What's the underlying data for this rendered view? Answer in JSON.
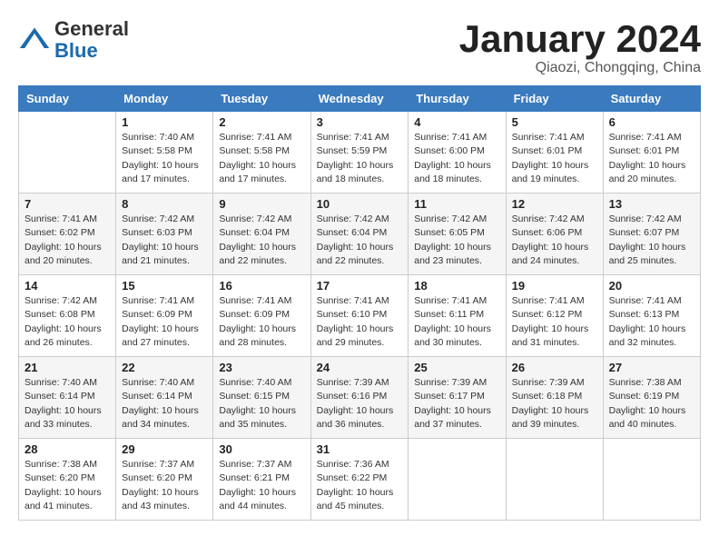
{
  "header": {
    "logo_line1": "General",
    "logo_line2": "Blue",
    "month_title": "January 2024",
    "location": "Qiaozi, Chongqing, China"
  },
  "days_of_week": [
    "Sunday",
    "Monday",
    "Tuesday",
    "Wednesday",
    "Thursday",
    "Friday",
    "Saturday"
  ],
  "weeks": [
    [
      {
        "day": "",
        "sunrise": "",
        "sunset": "",
        "daylight": ""
      },
      {
        "day": "1",
        "sunrise": "Sunrise: 7:40 AM",
        "sunset": "Sunset: 5:58 PM",
        "daylight": "Daylight: 10 hours and 17 minutes."
      },
      {
        "day": "2",
        "sunrise": "Sunrise: 7:41 AM",
        "sunset": "Sunset: 5:58 PM",
        "daylight": "Daylight: 10 hours and 17 minutes."
      },
      {
        "day": "3",
        "sunrise": "Sunrise: 7:41 AM",
        "sunset": "Sunset: 5:59 PM",
        "daylight": "Daylight: 10 hours and 18 minutes."
      },
      {
        "day": "4",
        "sunrise": "Sunrise: 7:41 AM",
        "sunset": "Sunset: 6:00 PM",
        "daylight": "Daylight: 10 hours and 18 minutes."
      },
      {
        "day": "5",
        "sunrise": "Sunrise: 7:41 AM",
        "sunset": "Sunset: 6:01 PM",
        "daylight": "Daylight: 10 hours and 19 minutes."
      },
      {
        "day": "6",
        "sunrise": "Sunrise: 7:41 AM",
        "sunset": "Sunset: 6:01 PM",
        "daylight": "Daylight: 10 hours and 20 minutes."
      }
    ],
    [
      {
        "day": "7",
        "sunrise": "Sunrise: 7:41 AM",
        "sunset": "Sunset: 6:02 PM",
        "daylight": "Daylight: 10 hours and 20 minutes."
      },
      {
        "day": "8",
        "sunrise": "Sunrise: 7:42 AM",
        "sunset": "Sunset: 6:03 PM",
        "daylight": "Daylight: 10 hours and 21 minutes."
      },
      {
        "day": "9",
        "sunrise": "Sunrise: 7:42 AM",
        "sunset": "Sunset: 6:04 PM",
        "daylight": "Daylight: 10 hours and 22 minutes."
      },
      {
        "day": "10",
        "sunrise": "Sunrise: 7:42 AM",
        "sunset": "Sunset: 6:04 PM",
        "daylight": "Daylight: 10 hours and 22 minutes."
      },
      {
        "day": "11",
        "sunrise": "Sunrise: 7:42 AM",
        "sunset": "Sunset: 6:05 PM",
        "daylight": "Daylight: 10 hours and 23 minutes."
      },
      {
        "day": "12",
        "sunrise": "Sunrise: 7:42 AM",
        "sunset": "Sunset: 6:06 PM",
        "daylight": "Daylight: 10 hours and 24 minutes."
      },
      {
        "day": "13",
        "sunrise": "Sunrise: 7:42 AM",
        "sunset": "Sunset: 6:07 PM",
        "daylight": "Daylight: 10 hours and 25 minutes."
      }
    ],
    [
      {
        "day": "14",
        "sunrise": "Sunrise: 7:42 AM",
        "sunset": "Sunset: 6:08 PM",
        "daylight": "Daylight: 10 hours and 26 minutes."
      },
      {
        "day": "15",
        "sunrise": "Sunrise: 7:41 AM",
        "sunset": "Sunset: 6:09 PM",
        "daylight": "Daylight: 10 hours and 27 minutes."
      },
      {
        "day": "16",
        "sunrise": "Sunrise: 7:41 AM",
        "sunset": "Sunset: 6:09 PM",
        "daylight": "Daylight: 10 hours and 28 minutes."
      },
      {
        "day": "17",
        "sunrise": "Sunrise: 7:41 AM",
        "sunset": "Sunset: 6:10 PM",
        "daylight": "Daylight: 10 hours and 29 minutes."
      },
      {
        "day": "18",
        "sunrise": "Sunrise: 7:41 AM",
        "sunset": "Sunset: 6:11 PM",
        "daylight": "Daylight: 10 hours and 30 minutes."
      },
      {
        "day": "19",
        "sunrise": "Sunrise: 7:41 AM",
        "sunset": "Sunset: 6:12 PM",
        "daylight": "Daylight: 10 hours and 31 minutes."
      },
      {
        "day": "20",
        "sunrise": "Sunrise: 7:41 AM",
        "sunset": "Sunset: 6:13 PM",
        "daylight": "Daylight: 10 hours and 32 minutes."
      }
    ],
    [
      {
        "day": "21",
        "sunrise": "Sunrise: 7:40 AM",
        "sunset": "Sunset: 6:14 PM",
        "daylight": "Daylight: 10 hours and 33 minutes."
      },
      {
        "day": "22",
        "sunrise": "Sunrise: 7:40 AM",
        "sunset": "Sunset: 6:14 PM",
        "daylight": "Daylight: 10 hours and 34 minutes."
      },
      {
        "day": "23",
        "sunrise": "Sunrise: 7:40 AM",
        "sunset": "Sunset: 6:15 PM",
        "daylight": "Daylight: 10 hours and 35 minutes."
      },
      {
        "day": "24",
        "sunrise": "Sunrise: 7:39 AM",
        "sunset": "Sunset: 6:16 PM",
        "daylight": "Daylight: 10 hours and 36 minutes."
      },
      {
        "day": "25",
        "sunrise": "Sunrise: 7:39 AM",
        "sunset": "Sunset: 6:17 PM",
        "daylight": "Daylight: 10 hours and 37 minutes."
      },
      {
        "day": "26",
        "sunrise": "Sunrise: 7:39 AM",
        "sunset": "Sunset: 6:18 PM",
        "daylight": "Daylight: 10 hours and 39 minutes."
      },
      {
        "day": "27",
        "sunrise": "Sunrise: 7:38 AM",
        "sunset": "Sunset: 6:19 PM",
        "daylight": "Daylight: 10 hours and 40 minutes."
      }
    ],
    [
      {
        "day": "28",
        "sunrise": "Sunrise: 7:38 AM",
        "sunset": "Sunset: 6:20 PM",
        "daylight": "Daylight: 10 hours and 41 minutes."
      },
      {
        "day": "29",
        "sunrise": "Sunrise: 7:37 AM",
        "sunset": "Sunset: 6:20 PM",
        "daylight": "Daylight: 10 hours and 43 minutes."
      },
      {
        "day": "30",
        "sunrise": "Sunrise: 7:37 AM",
        "sunset": "Sunset: 6:21 PM",
        "daylight": "Daylight: 10 hours and 44 minutes."
      },
      {
        "day": "31",
        "sunrise": "Sunrise: 7:36 AM",
        "sunset": "Sunset: 6:22 PM",
        "daylight": "Daylight: 10 hours and 45 minutes."
      },
      {
        "day": "",
        "sunrise": "",
        "sunset": "",
        "daylight": ""
      },
      {
        "day": "",
        "sunrise": "",
        "sunset": "",
        "daylight": ""
      },
      {
        "day": "",
        "sunrise": "",
        "sunset": "",
        "daylight": ""
      }
    ]
  ]
}
